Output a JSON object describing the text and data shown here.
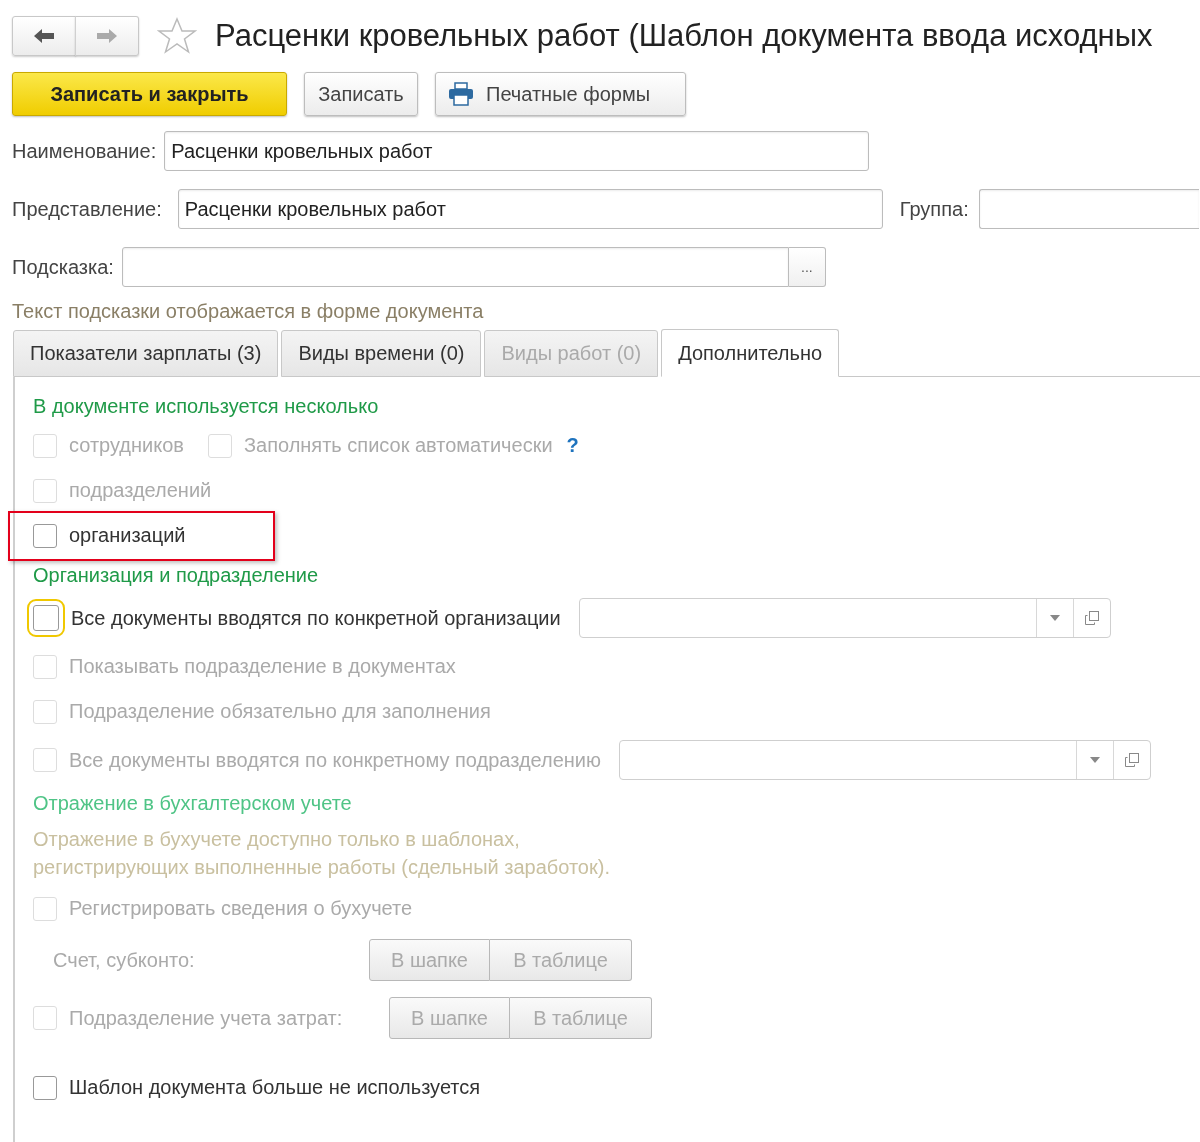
{
  "nav_buttons": [
    {
      "kind": "back",
      "disabled": false
    },
    {
      "kind": "forward",
      "disabled": true
    }
  ],
  "favorite": {
    "checked": false
  },
  "title": "Расценки кровельных работ (Шаблон документа ввода исходных",
  "toolbar": [
    {
      "kind": "primary",
      "label": "Записать и закрыть"
    },
    {
      "kind": "plain",
      "label": "Записать"
    },
    {
      "kind": "print",
      "label": "Печатные формы"
    }
  ],
  "name_field": {
    "label": "Наименование:",
    "value": "Расценки кровельных работ"
  },
  "presentation_field": {
    "label": "Представление:",
    "value": "Расценки кровельных работ"
  },
  "group_field": {
    "label": "Группа:"
  },
  "hint_field": {
    "label": "Подсказка:",
    "select_button": "..."
  },
  "hint_note": "Текст подсказки отображается в форме документа",
  "tabs": [
    {
      "label": "Показатели зарплаты (3)",
      "selected": false,
      "disabled": false
    },
    {
      "label": "Виды времени (0)",
      "selected": false,
      "disabled": false
    },
    {
      "label": "Виды работ (0)",
      "selected": false,
      "disabled": true
    },
    {
      "label": "Дополнительно",
      "selected": true,
      "disabled": false
    }
  ],
  "rows": [
    {
      "kind": "heading",
      "text": "В документе используется несколько",
      "disabled": false
    },
    {
      "kind": "checks",
      "items": [
        {
          "label": "сотрудников",
          "checked": false,
          "disabled": true
        },
        {
          "label": "Заполнять список автоматически",
          "checked": false,
          "disabled": true
        }
      ],
      "help": "?"
    },
    {
      "kind": "check",
      "label": "подразделений",
      "checked": false,
      "disabled": true,
      "highlighted": false,
      "focused": false
    },
    {
      "kind": "check",
      "label": "организаций",
      "checked": false,
      "disabled": false,
      "highlighted": true,
      "focused": false
    },
    {
      "kind": "heading",
      "text": "Организация и подразделение",
      "disabled": false
    },
    {
      "kind": "check_field",
      "label": "Все документы вводятся по конкретной организации",
      "checked": false,
      "disabled": false,
      "focused": true
    },
    {
      "kind": "check",
      "label": "Показывать подразделение в документах",
      "checked": false,
      "disabled": true,
      "highlighted": false,
      "focused": false
    },
    {
      "kind": "check",
      "label": "Подразделение обязательно для заполнения",
      "checked": false,
      "disabled": true,
      "highlighted": false,
      "focused": false
    },
    {
      "kind": "check_field",
      "label": "Все документы вводятся по конкретному подразделению",
      "checked": false,
      "disabled": true,
      "focused": false
    },
    {
      "kind": "heading",
      "text": "Отражение в бухгалтерском учете",
      "disabled": true
    },
    {
      "kind": "note",
      "text": "Отражение в бухучете доступно только в шаблонах,\nрегистрирующих выполненные работы (сдельный заработок)."
    },
    {
      "kind": "check",
      "label": "Регистрировать сведения о бухучете",
      "checked": false,
      "disabled": true,
      "highlighted": false,
      "focused": false
    },
    {
      "kind": "toggle",
      "label": "Счет, субконто:",
      "disabled": true,
      "options": [
        {
          "label": "В шапке",
          "selected": false
        },
        {
          "label": "В таблице",
          "selected": false
        }
      ]
    },
    {
      "kind": "check_toggle",
      "label": "Подразделение учета затрат:",
      "checked": false,
      "disabled": true,
      "options": [
        {
          "label": "В шапке",
          "selected": false
        },
        {
          "label": "В таблице",
          "selected": false
        }
      ]
    },
    {
      "kind": "check",
      "label": "Шаблон документа больше не используется",
      "checked": false,
      "disabled": false,
      "highlighted": false,
      "focused": false
    }
  ]
}
